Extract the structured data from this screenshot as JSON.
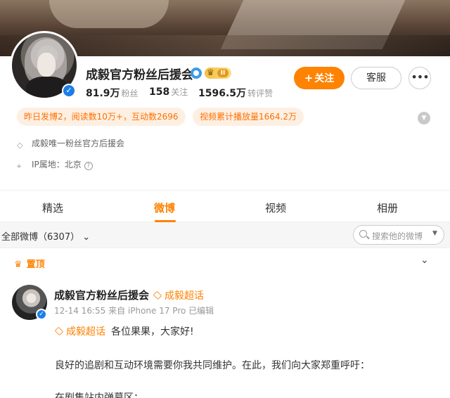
{
  "profile": {
    "name": "成毅官方粉丝后援会",
    "crown_level": "II",
    "stats": {
      "fans_value": "81.9万",
      "fans_label": "粉丝",
      "following_value": "158",
      "following_label": "关注",
      "reposts_value": "1596.5万",
      "reposts_label": "转评赞"
    },
    "buttons": {
      "follow": "关注",
      "chat": "客服",
      "more": "•••"
    },
    "highlights": [
      "昨日发博2，阅读数10万+，互动数2696",
      "视频累计播放量1664.2万"
    ],
    "description": "成毅唯一粉丝官方后援会",
    "ip_location": "IP属地：北京"
  },
  "tabs": [
    {
      "label": "精选",
      "active": false
    },
    {
      "label": "微博",
      "active": true
    },
    {
      "label": "视频",
      "active": false
    },
    {
      "label": "相册",
      "active": false
    }
  ],
  "filter": {
    "label": "全部微博（6307）",
    "search_placeholder": "搜索他的微博"
  },
  "feed": {
    "pinned_label": "置顶",
    "post": {
      "author": "成毅官方粉丝后援会",
      "super_topic": "成毅超话",
      "meta": "12-14 16:55  来自 iPhone 17 Pro 已编辑",
      "line1_tag": "成毅超话",
      "line1_text": "各位果果，大家好!",
      "line2": "良好的追剧和互动环境需要你我共同维护。在此，我们向大家郑重呼吁：",
      "line3": "在剧集站内弹幕区："
    }
  },
  "colors": {
    "accent": "#ff8200",
    "verified_blue": "#1c7ee8"
  }
}
